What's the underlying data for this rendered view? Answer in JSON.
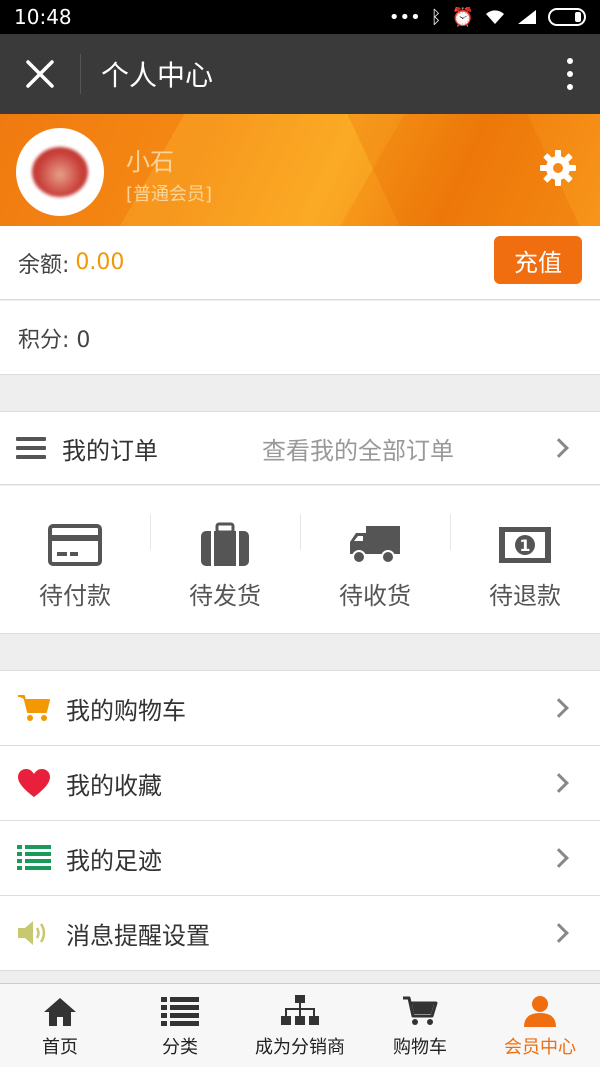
{
  "status_bar": {
    "time": "10:48"
  },
  "nav": {
    "title": "个人中心"
  },
  "profile": {
    "name": "小石",
    "level": "[普通会员]"
  },
  "balance": {
    "label": "余额:",
    "value": "0.00",
    "recharge_label": "充值"
  },
  "points": {
    "text": "积分: 0"
  },
  "orders": {
    "title": "我的订单",
    "view_all": "查看我的全部订单",
    "statuses": [
      {
        "label": "待付款",
        "icon": "credit-card-icon"
      },
      {
        "label": "待发货",
        "icon": "suitcase-icon"
      },
      {
        "label": "待收货",
        "icon": "truck-icon"
      },
      {
        "label": "待退款",
        "icon": "money-icon"
      }
    ]
  },
  "menu": [
    {
      "label": "我的购物车",
      "icon": "cart-icon",
      "color": "#f39800"
    },
    {
      "label": "我的收藏",
      "icon": "heart-icon",
      "color": "#e8203c"
    },
    {
      "label": "我的足迹",
      "icon": "list-icon",
      "color": "#1a9a58"
    },
    {
      "label": "消息提醒设置",
      "icon": "speaker-icon",
      "color": "#c8c870"
    }
  ],
  "tabs": [
    {
      "label": "首页",
      "icon": "home-icon"
    },
    {
      "label": "分类",
      "icon": "list-icon"
    },
    {
      "label": "成为分销商",
      "icon": "sitemap-icon"
    },
    {
      "label": "购物车",
      "icon": "cart-icon"
    },
    {
      "label": "会员中心",
      "icon": "user-icon",
      "active": true
    }
  ],
  "colors": {
    "accent": "#f06d10",
    "balance": "#f39800",
    "navbar": "#3a3a3a"
  }
}
